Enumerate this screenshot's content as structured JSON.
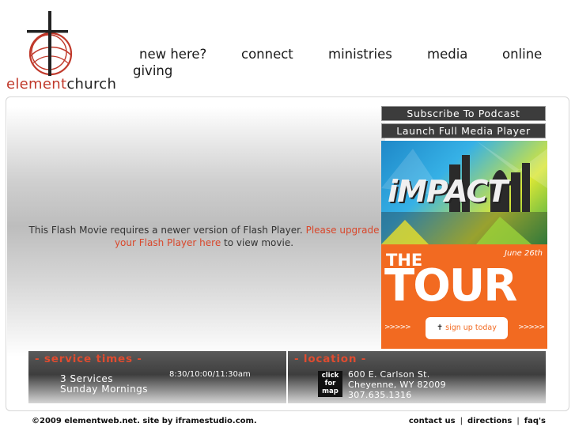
{
  "brand": {
    "name_part1": "element",
    "name_part2": "church"
  },
  "nav": {
    "items": [
      "new here?",
      "connect",
      "ministries",
      "media",
      "online",
      "giving"
    ]
  },
  "flash": {
    "message_text": "This Flash Movie requires a newer version of Flash Player.",
    "upgrade_link": "Please upgrade your Flash Player here",
    "suffix": "to view movie."
  },
  "sidebar": {
    "podcast_button": "Subscribe To Podcast",
    "player_button": "Launch Full Media Player",
    "impact_banner": "iMPACT",
    "tour": {
      "the": "THE",
      "word": "TOUR",
      "date": "June 26th",
      "signup": "sign up today",
      "arrows": ">>>>>"
    }
  },
  "service": {
    "title": "- service times -",
    "line1": "3 Services",
    "line2": "Sunday Mornings",
    "times": "8:30/10:00/11:30am"
  },
  "location": {
    "title": "- location -",
    "map_button": "click for map",
    "address_line1": "600 E. Carlson St.",
    "address_line2": "Cheyenne, WY 82009",
    "phone": "307.635.1316"
  },
  "footer": {
    "copyright": "©2009 elementweb.net. site by iframestudio.com.",
    "links": [
      "contact us",
      "directions",
      "faq's"
    ],
    "separator": "|"
  },
  "colors": {
    "accent": "#c0392b",
    "link": "#d9472b",
    "tour_orange": "#f26a21",
    "panel_dark": "#3e3e3e"
  }
}
